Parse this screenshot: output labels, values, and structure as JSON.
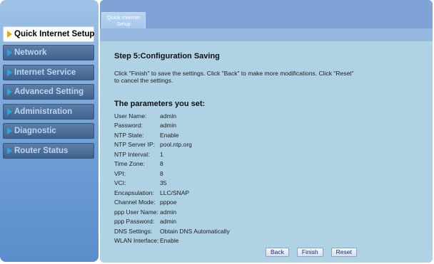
{
  "sidebar": {
    "items": [
      {
        "label": "Quick Internet Setup",
        "active": true
      },
      {
        "label": "Network"
      },
      {
        "label": "Internet Service"
      },
      {
        "label": "Advanced Setting"
      },
      {
        "label": "Administration"
      },
      {
        "label": "Diagnostic"
      },
      {
        "label": "Router Status"
      }
    ]
  },
  "tab": {
    "label": "Quick Internet Setup"
  },
  "step": {
    "title": "Step 5:Configuration Saving",
    "description": "Click \"Finish\" to save the settings. Click \"Back\" to make more modifications. Click \"Reset\" to cancel the settings."
  },
  "params": {
    "title": "The parameters you set:",
    "rows": [
      {
        "key": "User Name:",
        "value": "admin"
      },
      {
        "key": "Password:",
        "value": "admin"
      },
      {
        "key": "NTP State:",
        "value": "Enable"
      },
      {
        "key": "NTP Server IP:",
        "value": "pool.ntp.org"
      },
      {
        "key": "NTP Interval:",
        "value": "1"
      },
      {
        "key": "Time Zone:",
        "value": "8"
      },
      {
        "key": "VPI:",
        "value": "8"
      },
      {
        "key": "VCI:",
        "value": "35"
      },
      {
        "key": "Encapsulation:",
        "value": "LLC/SNAP"
      },
      {
        "key": "Channel Mode:",
        "value": "pppoe"
      },
      {
        "key": "ppp User Name:",
        "value": "admin"
      },
      {
        "key": "ppp Password:",
        "value": "admin"
      },
      {
        "key": "DNS Settings:",
        "value": "Obtain DNS Automatically"
      },
      {
        "key": "WLAN Interface:",
        "value": "Enable"
      }
    ]
  },
  "buttons": {
    "back": "Back",
    "finish": "Finish",
    "reset": "Reset"
  }
}
